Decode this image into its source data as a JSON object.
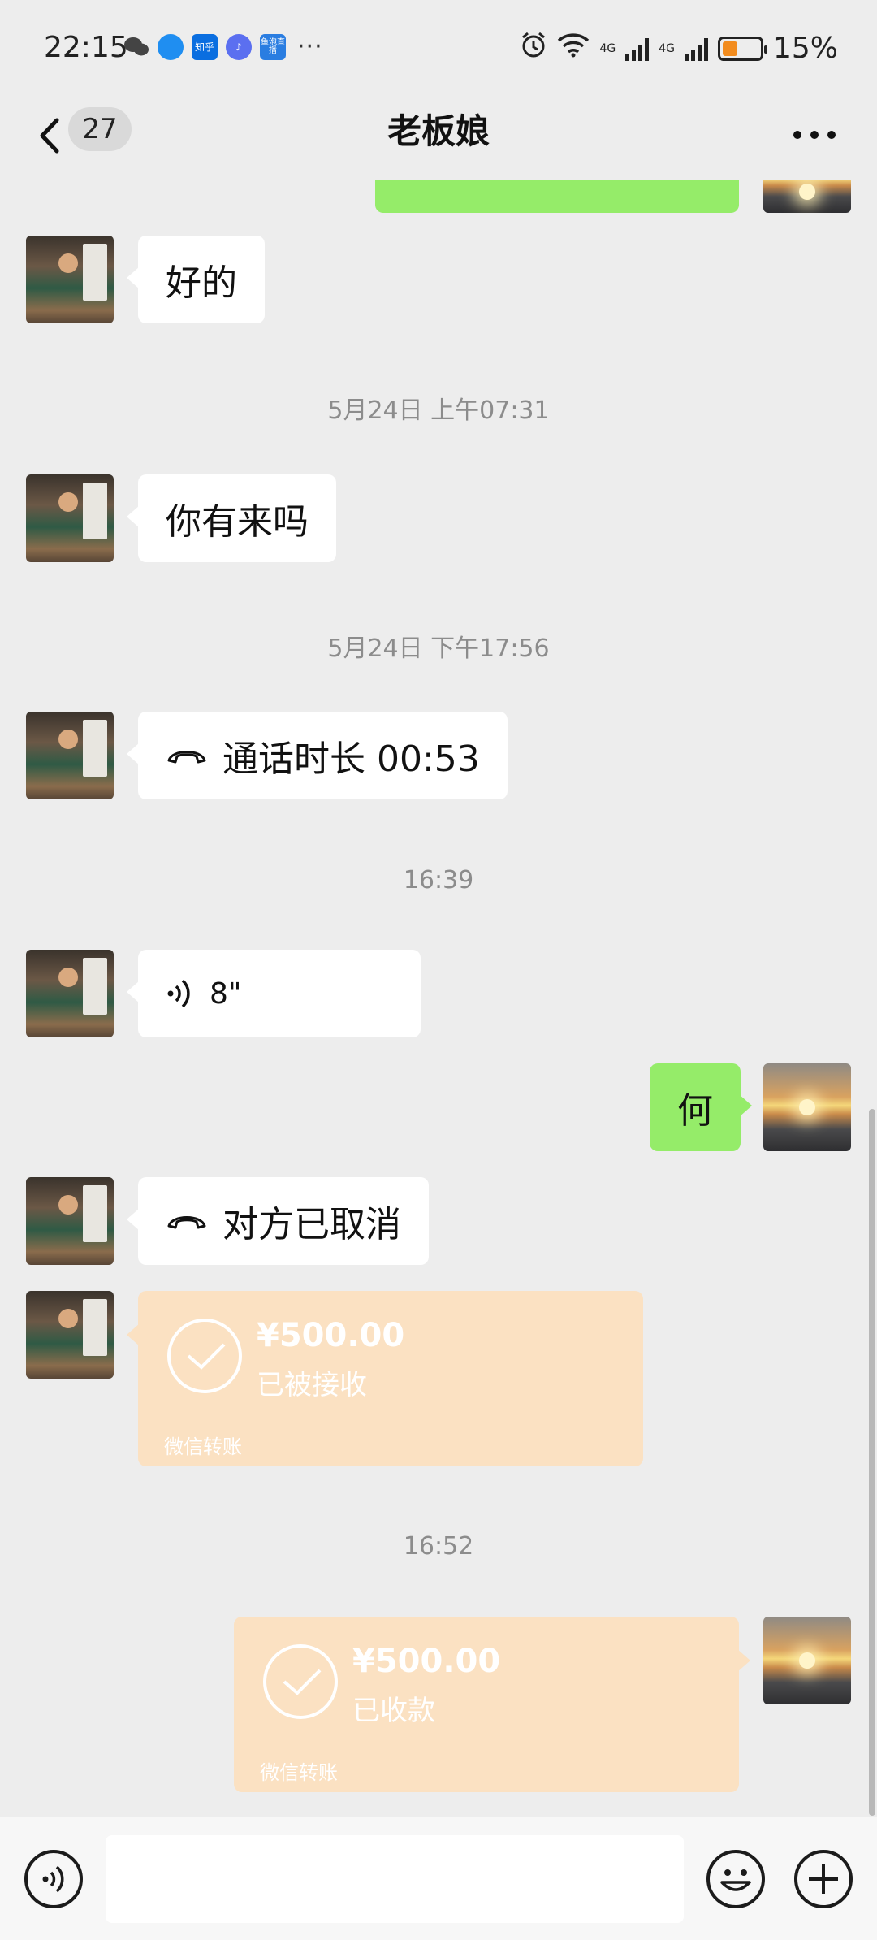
{
  "status_bar": {
    "time": "22:15",
    "apps": [
      "wechat-icon",
      "qq-browser-icon",
      "zhihu-icon",
      "music-icon",
      "douyu-icon"
    ],
    "app_labels": {
      "zhihu": "知乎",
      "douyu": "鱼泡直播"
    },
    "more": "···",
    "network_1": "4G",
    "network_2": "4G",
    "battery": "15%",
    "battery_level": 0.15
  },
  "header": {
    "back_label": "<",
    "unread_count": "27",
    "title": "老板娘",
    "more_label": "···"
  },
  "messages": {
    "m1": {
      "text": "好的"
    },
    "ts1": "5月24日 上午07:31",
    "m2": {
      "text": "你有来吗"
    },
    "ts2": "5月24日 下午17:56",
    "m3": {
      "text": "通话时长 00:53"
    },
    "ts3": "16:39",
    "m4": {
      "duration": "8\""
    },
    "m5": {
      "text": "何"
    },
    "m6": {
      "text": "对方已取消"
    },
    "t1": {
      "amount": "¥500.00",
      "status": "已被接收",
      "footer": "微信转账"
    },
    "ts4": "16:52",
    "t2": {
      "amount": "¥500.00",
      "status": "已收款",
      "footer": "微信转账"
    }
  },
  "input_bar": {
    "voice_icon": "voice-mode-icon",
    "emoji_icon": "emoji-icon",
    "plus_icon": "plus-icon",
    "input_value": ""
  },
  "colors": {
    "background": "#ededed",
    "bubble_me": "#95ec69",
    "bubble_other": "#ffffff",
    "transfer": "#fbe1c2"
  }
}
